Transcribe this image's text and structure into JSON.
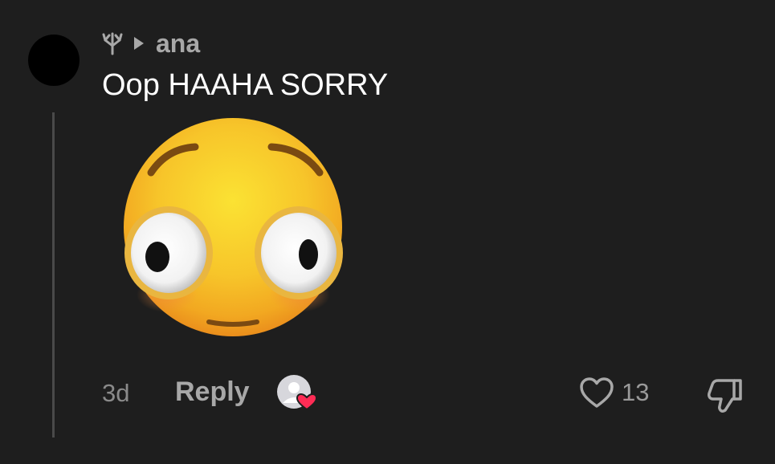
{
  "comment": {
    "username": "ana",
    "text": "Oop HAAHA SORRY",
    "sticker": "flushed-face-sticker",
    "timestamp": "3d",
    "reply_label": "Reply",
    "like_count": "13",
    "liked_by_creator": true
  },
  "icons": {
    "author_badge": "tree-icon",
    "reply_to": "caret-right-icon",
    "like": "heart-outline-icon",
    "dislike": "thumbs-down-icon",
    "creator_like": "creator-heart-icon"
  },
  "colors": {
    "background": "#1e1e1e",
    "text_primary": "#ffffff",
    "text_secondary": "#a8a8a8",
    "creator_heart": "#fe2c55",
    "thread_line": "#4a4a4a"
  }
}
